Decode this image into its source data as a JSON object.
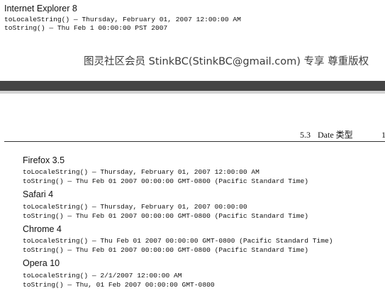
{
  "top_section": {
    "heading": "Internet Explorer 8",
    "lines": [
      "toLocaleString() — Thursday, February 01, 2007 12:00:00 AM",
      "toString() — Thu Feb 1 00:00:00 PST 2007"
    ]
  },
  "watermark": "图灵社区会员 StinkBC(StinkBC@gmail.com) 专享 尊重版权",
  "running_header": {
    "section": "5.3",
    "title": "Date 类型",
    "page_number": "1"
  },
  "browsers": [
    {
      "name": "Firefox 3.5",
      "lines": [
        "toLocaleString() — Thursday, February 01, 2007 12:00:00 AM",
        "toString() — Thu Feb 01 2007 00:00:00 GMT-0800 (Pacific Standard Time)"
      ]
    },
    {
      "name": "Safari 4",
      "lines": [
        "toLocaleString() — Thursday, February 01, 2007 00:00:00",
        "toString() — Thu Feb 01 2007 00:00:00 GMT-0800 (Pacific Standard Time)"
      ]
    },
    {
      "name": "Chrome 4",
      "lines": [
        "toLocaleString() — Thu Feb 01 2007 00:00:00 GMT-0800 (Pacific Standard Time)",
        "toString() — Thu Feb 01 2007 00:00:00 GMT-0800 (Pacific Standard Time)"
      ]
    },
    {
      "name": "Opera 10",
      "lines": [
        "toLocaleString() — 2/1/2007 12:00:00 AM",
        "toString() — Thu, 01 Feb 2007 00:00:00 GMT-0800"
      ]
    }
  ]
}
